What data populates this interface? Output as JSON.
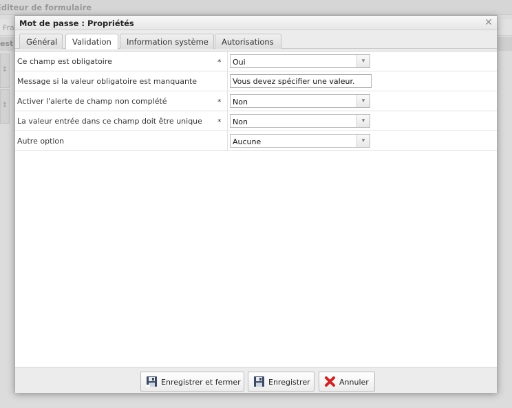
{
  "background": {
    "title": "Éditeur de formulaire",
    "toolbar_text": "Fra",
    "section_text": "est",
    "handle_glyph": "↕"
  },
  "dialog": {
    "title": "Mot de passe : Propriétés",
    "close_glyph": "✕",
    "tabs": [
      {
        "label": "Général",
        "active": false
      },
      {
        "label": "Validation",
        "active": true
      },
      {
        "label": "Information système",
        "active": false
      },
      {
        "label": "Autorisations",
        "active": false
      }
    ],
    "rows": [
      {
        "label": "Ce champ est obligatoire",
        "required_mark": "*",
        "type": "select",
        "value": "Oui"
      },
      {
        "label": "Message si la valeur obligatoire est manquante",
        "required_mark": "",
        "type": "text",
        "value": "Vous devez spécifier une valeur."
      },
      {
        "label": "Activer l'alerte de champ non complété",
        "required_mark": "*",
        "type": "select",
        "value": "Non"
      },
      {
        "label": "La valeur entrée dans ce champ doit être unique",
        "required_mark": "*",
        "type": "select",
        "value": "Non"
      },
      {
        "label": "Autre option",
        "required_mark": "",
        "type": "select",
        "value": "Aucune"
      }
    ],
    "dropdown_glyph": "▾",
    "buttons": {
      "save_close": "Enregistrer et fermer",
      "save": "Enregistrer",
      "cancel": "Annuler"
    },
    "icons": {
      "save_close": "save-close-icon",
      "save": "floppy-disk-icon",
      "cancel": "red-x-icon"
    },
    "colors": {
      "cancel_icon": "#d32020",
      "floppy_body": "#3a4a66",
      "floppy_label": "#eaeaea"
    }
  }
}
